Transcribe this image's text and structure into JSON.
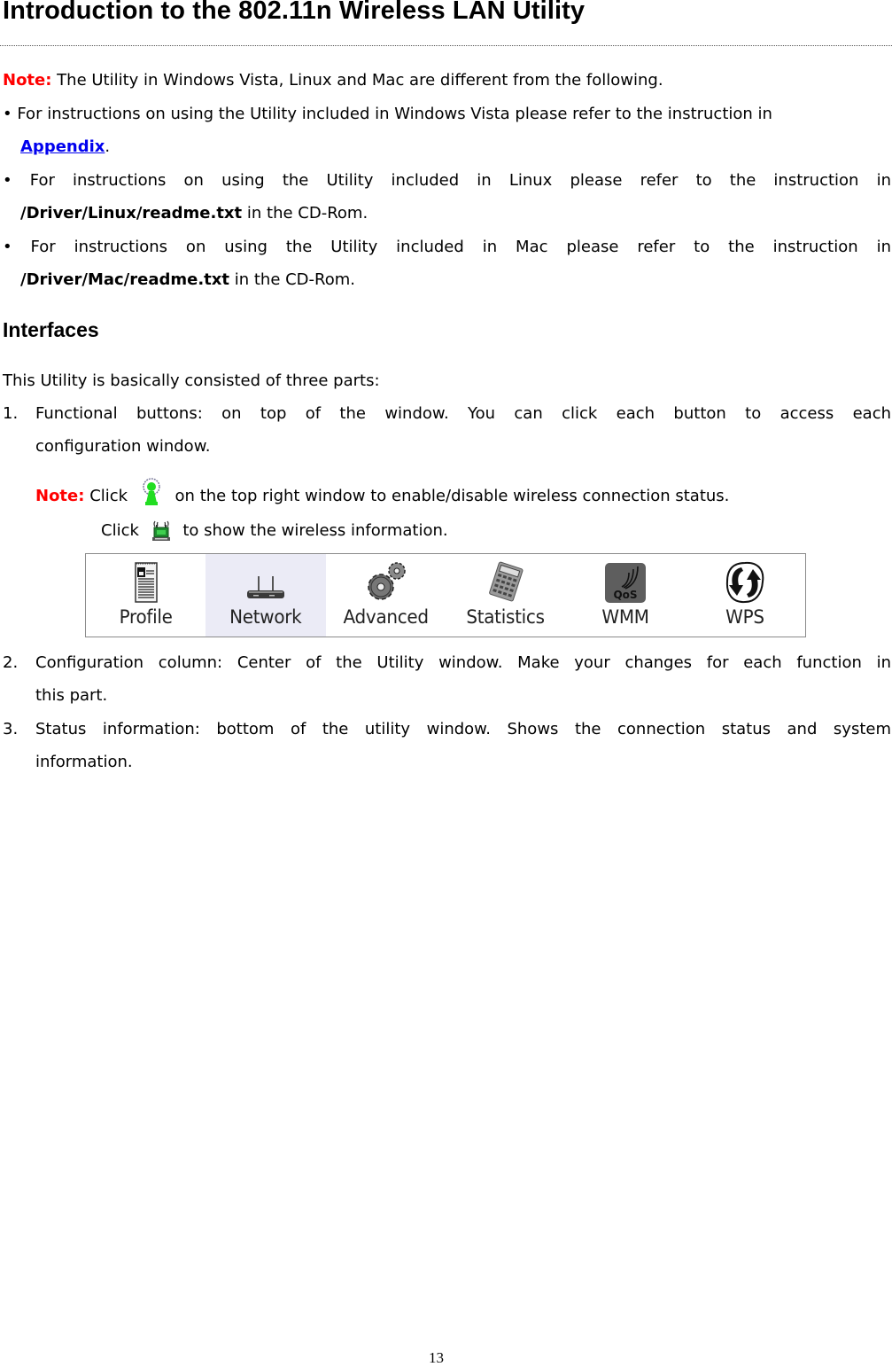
{
  "title": "Introduction to the 802.11n Wireless LAN Utility",
  "note": {
    "label": "Note:",
    "text": " The Utility in Windows Vista, Linux and Mac are different from the following."
  },
  "bullets": [
    {
      "bullet": "•",
      "text": " For instructions on using the Utility included in Windows Vista please refer to the instruction in",
      "link": "Appendix",
      "after": "."
    },
    {
      "bullet": "•",
      "text": " For instructions on using the Utility included in Linux please refer to the instruction in",
      "path": "/Driver/Linux/readme.txt",
      "after": " in the CD-Rom."
    },
    {
      "bullet": "•",
      "text": " For instructions on using the Utility included in Mac please refer to the instruction in",
      "path": "/Driver/Mac/readme.txt",
      "after": " in the CD-Rom."
    }
  ],
  "section": {
    "heading": "Interfaces",
    "intro": "This Utility is basically consisted of three parts:",
    "items": [
      {
        "num": "1.",
        "line1": "Functional buttons: on top of the window. You can click each button to access each",
        "line2": "configuration window."
      },
      {
        "num": "2.",
        "line1": "Configuration column: Center of the Utility window. Make your changes for each function in",
        "line2": "this part."
      },
      {
        "num": "3.",
        "line1": "Status information: bottom of the utility window. Shows the connection status and system",
        "line2": "information."
      }
    ],
    "sub_note": {
      "label": "Note:",
      "click1": "Click",
      "text1": "on the top right window to enable/disable wireless connection status.",
      "icon1": "radio-toggle-icon",
      "click2": "Click",
      "text2": "to show the wireless information.",
      "icon2": "wireless-info-icon"
    }
  },
  "toolbar": {
    "buttons": [
      {
        "label": "Profile",
        "icon": "profile-icon",
        "active": false
      },
      {
        "label": "Network",
        "icon": "network-icon",
        "active": true
      },
      {
        "label": "Advanced",
        "icon": "advanced-icon",
        "active": false
      },
      {
        "label": "Statistics",
        "icon": "statistics-icon",
        "active": false
      },
      {
        "label": "WMM",
        "icon": "wmm-qos-icon",
        "active": false
      },
      {
        "label": "WPS",
        "icon": "wps-icon",
        "active": false
      }
    ]
  },
  "colors": {
    "note_red": "#ff0000",
    "link_blue": "#0000ee",
    "active_button_bg": "#ebebf6",
    "toggle_green": "#22dd22"
  },
  "page_number": "13"
}
